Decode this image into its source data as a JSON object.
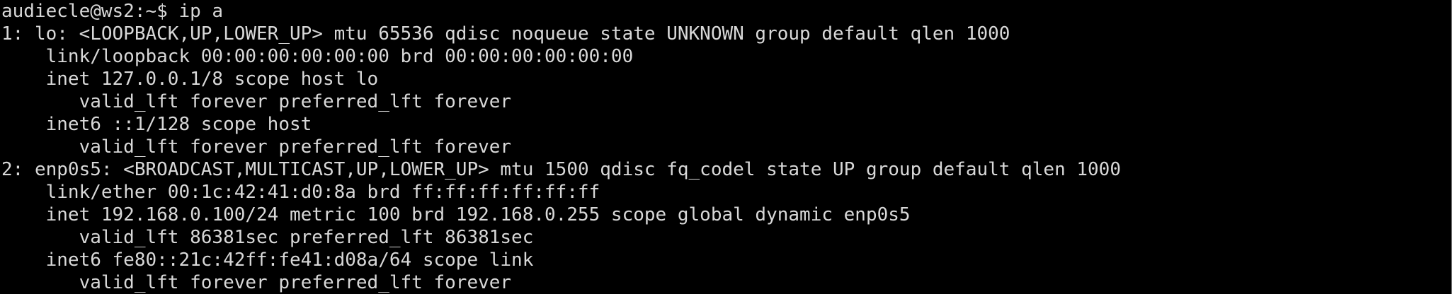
{
  "terminal": {
    "lines": [
      "audiecle@ws2:~$ ip a",
      "1: lo: <LOOPBACK,UP,LOWER_UP> mtu 65536 qdisc noqueue state UNKNOWN group default qlen 1000",
      "    link/loopback 00:00:00:00:00:00 brd 00:00:00:00:00:00",
      "    inet 127.0.0.1/8 scope host lo",
      "       valid_lft forever preferred_lft forever",
      "    inet6 ::1/128 scope host",
      "       valid_lft forever preferred_lft forever",
      "2: enp0s5: <BROADCAST,MULTICAST,UP,LOWER_UP> mtu 1500 qdisc fq_codel state UP group default qlen 1000",
      "    link/ether 00:1c:42:41:d0:8a brd ff:ff:ff:ff:ff:ff",
      "    inet 192.168.0.100/24 metric 100 brd 192.168.0.255 scope global dynamic enp0s5",
      "       valid_lft 86381sec preferred_lft 86381sec",
      "    inet6 fe80::21c:42ff:fe41:d08a/64 scope link",
      "       valid_lft forever preferred_lft forever"
    ]
  }
}
